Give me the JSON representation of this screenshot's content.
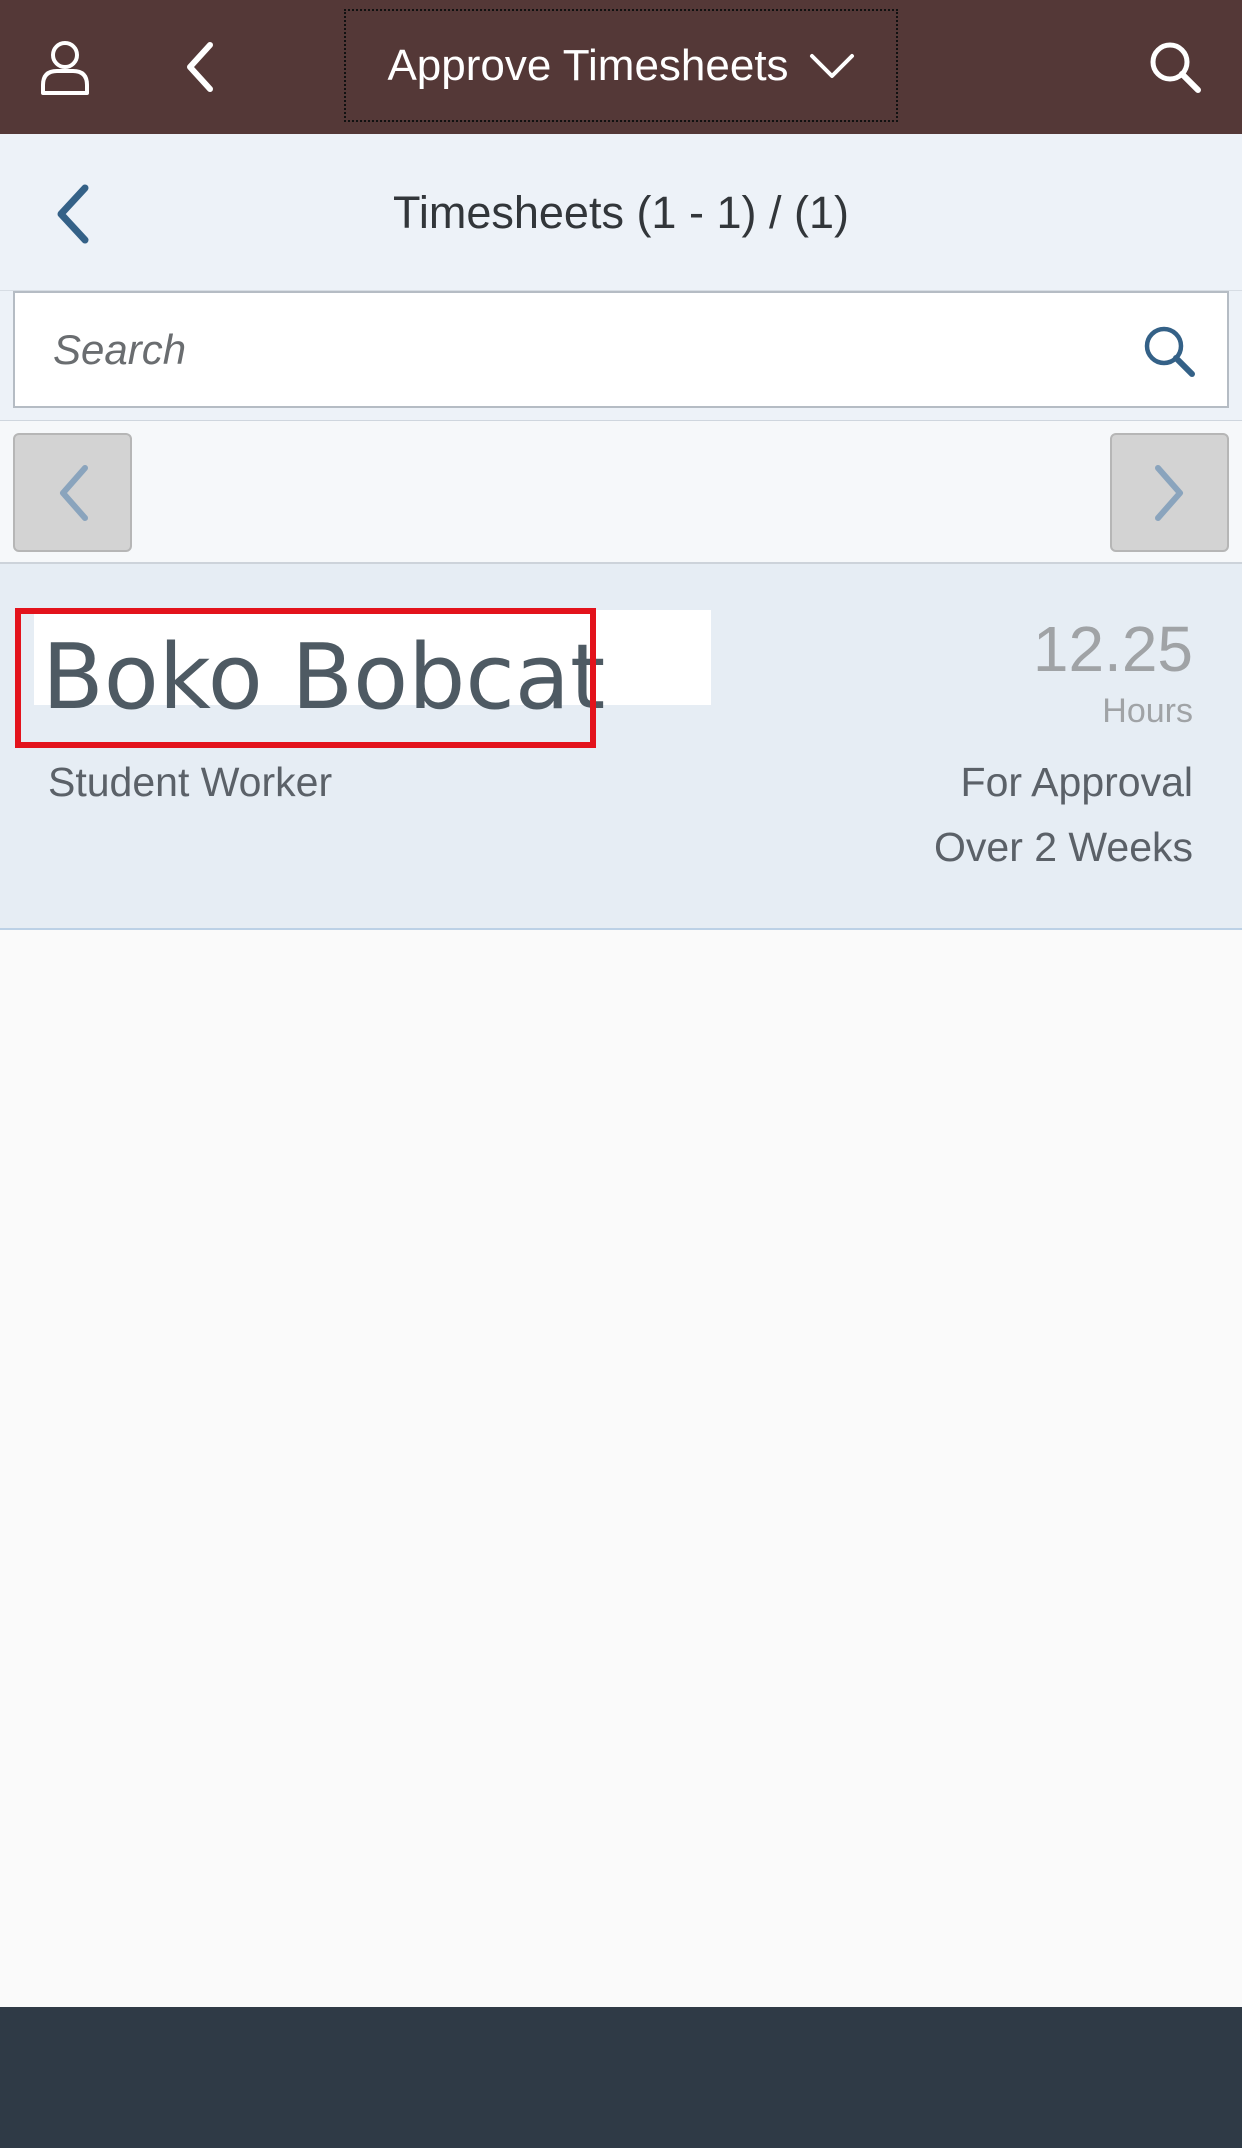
{
  "shell": {
    "title": "Approve Timesheets",
    "user_icon": "user-icon",
    "back_icon": "chevron-left-icon",
    "dropdown_icon": "chevron-down-icon",
    "search_icon": "search-icon",
    "background_color": "#543837"
  },
  "header": {
    "title": "Timesheets (1 - 1) / (1)",
    "back_icon": "chevron-left-icon"
  },
  "search": {
    "placeholder": "Search",
    "icon": "search-icon"
  },
  "pager": {
    "prev_icon": "chevron-left-icon",
    "next_icon": "chevron-right-icon"
  },
  "list": {
    "items": [
      {
        "name": "Boko Bobcat",
        "role": "Student Worker",
        "hours": "12.25",
        "hours_unit": "Hours",
        "status": "For Approval",
        "period": "Over 2 Weeks"
      }
    ]
  },
  "colors": {
    "highlight_border": "#e3131c",
    "footer": "#2f3a46",
    "accent": "#346187"
  }
}
